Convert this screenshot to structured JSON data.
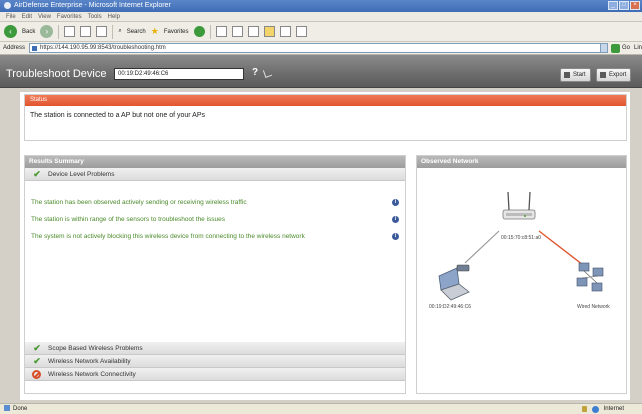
{
  "browser": {
    "title": "AirDefense Enterprise - Microsoft Internet Explorer",
    "menu": [
      "File",
      "Edit",
      "View",
      "Favorites",
      "Tools",
      "Help"
    ],
    "toolbar": {
      "back_label": "Back",
      "search_label": "Search",
      "favorites_label": "Favorites"
    },
    "address_label": "Address",
    "address_url": "https://144.190.95.99:8543/troubleshooting.htm",
    "go_label": "Go",
    "links_label": "Lin",
    "status_text": "Done",
    "zone_label": "Internet"
  },
  "app": {
    "title": "Troubleshoot Device",
    "device_mac": "00:19:D2:49:46:C6",
    "help_glyph": "?",
    "start_label": "Start",
    "export_label": "Export"
  },
  "status": {
    "heading": "Status",
    "message": "The station is connected to a AP but not one of your APs"
  },
  "results": {
    "heading": "Results Summary",
    "device_section": "Device Level Problems",
    "problems": [
      "The station has been observed actively sending or receiving wireless traffic",
      "The station is within range of the sensors to troubleshoot the issues",
      "The system is not actively blocking this wireless device from connecting to the wireless network"
    ],
    "info_glyph": "i",
    "sections": [
      {
        "label": "Scope Based Wireless Problems",
        "status": "ok"
      },
      {
        "label": "Wireless Network Availability",
        "status": "ok"
      },
      {
        "label": "Wireless Network Connectivity",
        "status": "blocked"
      }
    ]
  },
  "network": {
    "heading": "Observed Network",
    "ap_label": "00:15:70:c8:51:a0",
    "station_label": "00:19:D2:49:46:C6",
    "wired_label": "Wired Network",
    "colors": {
      "link_ok": "#9a9a9a",
      "link_alert": "#e0552f"
    }
  }
}
